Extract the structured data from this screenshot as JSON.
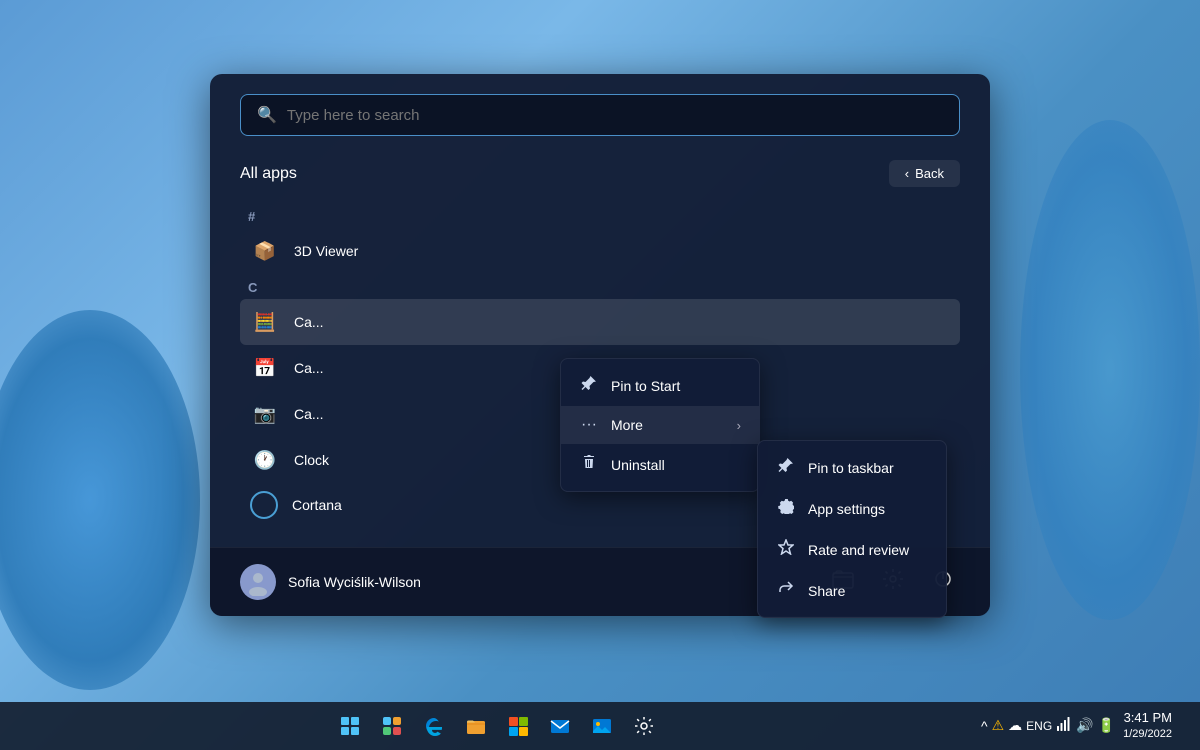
{
  "background": {
    "color_start": "#5b9bd5",
    "color_end": "#3d7db5"
  },
  "taskbar": {
    "icons": [
      {
        "name": "windows-start",
        "label": "Start",
        "symbol": "⊞"
      },
      {
        "name": "widgets",
        "label": "Widgets",
        "symbol": "▦"
      },
      {
        "name": "edge",
        "label": "Microsoft Edge",
        "symbol": "🌐"
      },
      {
        "name": "file-explorer",
        "label": "File Explorer",
        "symbol": "📁"
      },
      {
        "name": "microsoft-store",
        "label": "Microsoft Store",
        "symbol": "🛍"
      },
      {
        "name": "mail",
        "label": "Mail",
        "symbol": "✉"
      },
      {
        "name": "photos",
        "label": "Photos",
        "symbol": "🖼"
      },
      {
        "name": "settings-taskbar",
        "label": "Settings",
        "symbol": "⚙"
      }
    ],
    "system": {
      "chevron": "^",
      "warning": "⚠",
      "cloud": "☁",
      "language": "ENG",
      "network": "🖥",
      "volume": "🔊",
      "battery": "🔋"
    },
    "clock": {
      "time": "3:41 PM",
      "date": "1/29/2022"
    }
  },
  "start_menu": {
    "search": {
      "placeholder": "Type here to search"
    },
    "all_apps_label": "All apps",
    "back_button": "Back",
    "sections": [
      {
        "letter": "#",
        "apps": [
          {
            "name": "3D Viewer",
            "icon": "📦"
          }
        ]
      },
      {
        "letter": "C",
        "apps": [
          {
            "name": "Ca...",
            "icon": "🧮"
          },
          {
            "name": "Ca...",
            "icon": "📅"
          },
          {
            "name": "Ca...",
            "icon": "📷"
          },
          {
            "name": "Clock",
            "icon": "🕐"
          },
          {
            "name": "Cortana",
            "icon": "○"
          }
        ]
      }
    ],
    "context_menu": {
      "items": [
        {
          "label": "Pin to Start",
          "icon": "📌"
        },
        {
          "label": "More",
          "icon": "...",
          "has_submenu": true
        },
        {
          "label": "Uninstall",
          "icon": "🗑"
        }
      ],
      "submenu": {
        "items": [
          {
            "label": "Pin to taskbar",
            "icon": "📌"
          },
          {
            "label": "App settings",
            "icon": "⚙"
          },
          {
            "label": "Rate and review",
            "icon": "☆"
          },
          {
            "label": "Share",
            "icon": "↗"
          }
        ]
      }
    },
    "user": {
      "name": "Sofia Wyciślik-Wilson",
      "avatar": "👤"
    },
    "footer_buttons": [
      {
        "name": "file-explorer-footer",
        "icon": "📁"
      },
      {
        "name": "settings-footer",
        "icon": "⚙"
      },
      {
        "name": "power-footer",
        "icon": "⏻"
      }
    ]
  }
}
